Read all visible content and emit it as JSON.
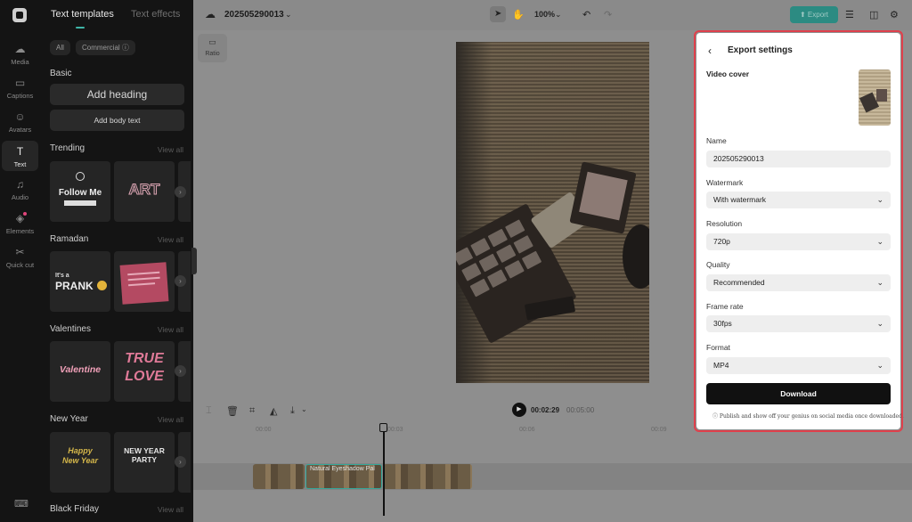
{
  "rail": {
    "items": [
      {
        "label": "Media",
        "icon": "cloud-icon"
      },
      {
        "label": "Captions",
        "icon": "captions-icon"
      },
      {
        "label": "Avatars",
        "icon": "avatar-icon"
      },
      {
        "label": "Text",
        "icon": "text-icon"
      },
      {
        "label": "Audio",
        "icon": "music-icon"
      },
      {
        "label": "Elements",
        "icon": "elements-icon"
      },
      {
        "label": "Quick cut",
        "icon": "scissors-icon"
      }
    ]
  },
  "panel": {
    "tab_templates": "Text templates",
    "tab_effects": "Text effects",
    "filter_all": "All",
    "filter_commercial": "Commercial ⓘ",
    "basic": "Basic",
    "add_heading": "Add heading",
    "add_body": "Add body text",
    "view_all": "View all",
    "sections": {
      "trending": "Trending",
      "ramadan": "Ramadan",
      "valentines": "Valentines",
      "new_year": "New Year",
      "black_friday": "Black Friday"
    },
    "thumbs": {
      "follow_me": "Follow Me",
      "art": "ART",
      "prank_top": "It's a",
      "prank": "PRANK",
      "valentine": "Valentine",
      "true_love": "TRUE LOVE",
      "happy_new_year": "Happy New Year",
      "new_year_party": "NEW YEAR PARTY"
    }
  },
  "topbar": {
    "project_name": "202505290013",
    "zoom": "100%",
    "export": "Export"
  },
  "canvas": {
    "ratio": "Ratio"
  },
  "timeline": {
    "current_time": "00:02:29",
    "total_time": "00:05:00",
    "ruler": [
      "00:00",
      "00:03",
      "00:06",
      "00:09"
    ],
    "clip_label": "Natural Eyeshadow Pal"
  },
  "export_dialog": {
    "title": "Export settings",
    "video_cover": "Video cover",
    "name_label": "Name",
    "name_value": "202505290013",
    "watermark_label": "Watermark",
    "watermark_value": "With watermark",
    "resolution_label": "Resolution",
    "resolution_value": "720p",
    "quality_label": "Quality",
    "quality_value": "Recommended",
    "frame_rate_label": "Frame rate",
    "frame_rate_value": "30fps",
    "format_label": "Format",
    "format_value": "MP4",
    "download": "Download",
    "note": "Publish and show off your genius on social media once downloaded."
  },
  "colors": {
    "accent": "#2c8b82",
    "highlight_outline": "#e0404c"
  }
}
